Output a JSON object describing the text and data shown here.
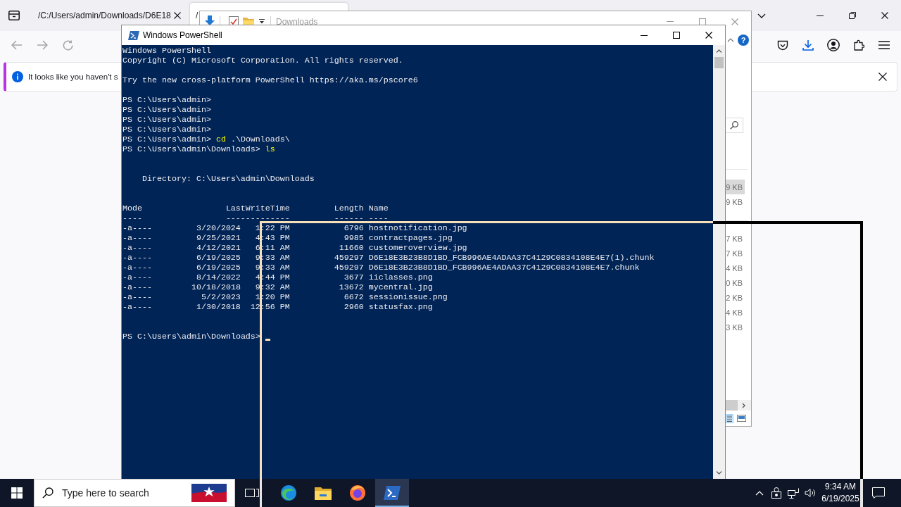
{
  "browser": {
    "tabs": [
      {
        "label": "/C:/Users/admin/Downloads/D6E18",
        "selected": false,
        "close_button": true
      },
      {
        "label": "/",
        "selected": true,
        "close_button": false
      }
    ],
    "notification": {
      "text": "It looks like you haven't s"
    }
  },
  "explorer": {
    "title": "Downloads",
    "help": "?",
    "groups": [
      {
        "sizes": [
          {
            "text": "9 KB",
            "selected": true
          },
          {
            "text": "9 KB",
            "selected": false
          }
        ]
      },
      {
        "sizes": [
          {
            "text": "7 KB",
            "selected": false
          },
          {
            "text": "7 KB",
            "selected": false
          },
          {
            "text": "4 KB",
            "selected": false
          },
          {
            "text": "0 KB",
            "selected": false
          },
          {
            "text": "2 KB",
            "selected": false
          },
          {
            "text": "4 KB",
            "selected": false
          },
          {
            "text": "3 KB",
            "selected": false
          }
        ]
      }
    ]
  },
  "powershell": {
    "title": "Windows PowerShell",
    "console": {
      "lines": [
        {
          "kind": "text",
          "text": "Windows PowerShell"
        },
        {
          "kind": "text",
          "text": "Copyright (C) Microsoft Corporation. All rights reserved."
        },
        {
          "kind": "blank"
        },
        {
          "kind": "text",
          "text": "Try the new cross-platform PowerShell https://aka.ms/pscore6"
        },
        {
          "kind": "blank"
        },
        {
          "kind": "prompt",
          "prompt": "PS C:\\Users\\admin>"
        },
        {
          "kind": "prompt",
          "prompt": "PS C:\\Users\\admin>"
        },
        {
          "kind": "prompt",
          "prompt": "PS C:\\Users\\admin>"
        },
        {
          "kind": "prompt",
          "prompt": "PS C:\\Users\\admin>"
        },
        {
          "kind": "prompt",
          "prompt": "PS C:\\Users\\admin>",
          "command": "cd",
          "argument": ".\\Downloads\\"
        },
        {
          "kind": "prompt",
          "prompt": "PS C:\\Users\\admin\\Downloads>",
          "command": "ls"
        },
        {
          "kind": "blank"
        },
        {
          "kind": "blank"
        },
        {
          "kind": "directory",
          "text": "Directory: C:\\Users\\admin\\Downloads"
        },
        {
          "kind": "blank"
        },
        {
          "kind": "blank"
        },
        {
          "kind": "listing",
          "columns": [
            {
              "label": "Mode",
              "rule": "----"
            },
            {
              "label": "LastWriteTime",
              "rule": "-------------"
            },
            {
              "label": "Length",
              "rule": "------"
            },
            {
              "label": "Name",
              "rule": "----"
            }
          ],
          "rows": [
            {
              "mode": "-a----",
              "date": "3/20/2024",
              "time": "1:22 PM",
              "length": "6796",
              "name": "hostnotification.jpg"
            },
            {
              "mode": "-a----",
              "date": "9/25/2021",
              "time": "4:43 PM",
              "length": "9985",
              "name": "contractpages.jpg"
            },
            {
              "mode": "-a----",
              "date": "4/12/2021",
              "time": "6:11 AM",
              "length": "11660",
              "name": "customeroverview.jpg"
            },
            {
              "mode": "-a----",
              "date": "6/19/2025",
              "time": "9:33 AM",
              "length": "459297",
              "name": "D6E18E3B23B8D1BD_FCB996AE4ADAA37C4129C0834108E4E7(1).chunk"
            },
            {
              "mode": "-a----",
              "date": "6/19/2025",
              "time": "9:33 AM",
              "length": "459297",
              "name": "D6E18E3B23B8D1BD_FCB996AE4ADAA37C4129C0834108E4E7.chunk"
            },
            {
              "mode": "-a----",
              "date": "8/14/2022",
              "time": "4:44 PM",
              "length": "3677",
              "name": "iiclasses.png"
            },
            {
              "mode": "-a----",
              "date": "10/18/2018",
              "time": "9:32 AM",
              "length": "13672",
              "name": "mycentral.jpg"
            },
            {
              "mode": "-a----",
              "date": "5/2/2023",
              "time": "1:20 PM",
              "length": "6672",
              "name": "sessionissue.png"
            },
            {
              "mode": "-a----",
              "date": "1/30/2018",
              "time": "12:56 PM",
              "length": "2960",
              "name": "statusfax.png"
            }
          ]
        },
        {
          "kind": "blank"
        },
        {
          "kind": "blank"
        },
        {
          "kind": "prompt",
          "prompt": "PS C:\\Users\\admin\\Downloads>",
          "cursor": true
        }
      ]
    }
  },
  "taskbar": {
    "search": {
      "placeholder": "Type here to search"
    },
    "apps": [
      {
        "kind": "browser",
        "selected": false
      },
      {
        "kind": "folder",
        "selected": false
      },
      {
        "kind": "globe",
        "selected": false
      },
      {
        "kind": "terminal",
        "selected": true
      }
    ],
    "clock": {
      "time": "9:34 AM",
      "date": "6/19/2025"
    }
  }
}
